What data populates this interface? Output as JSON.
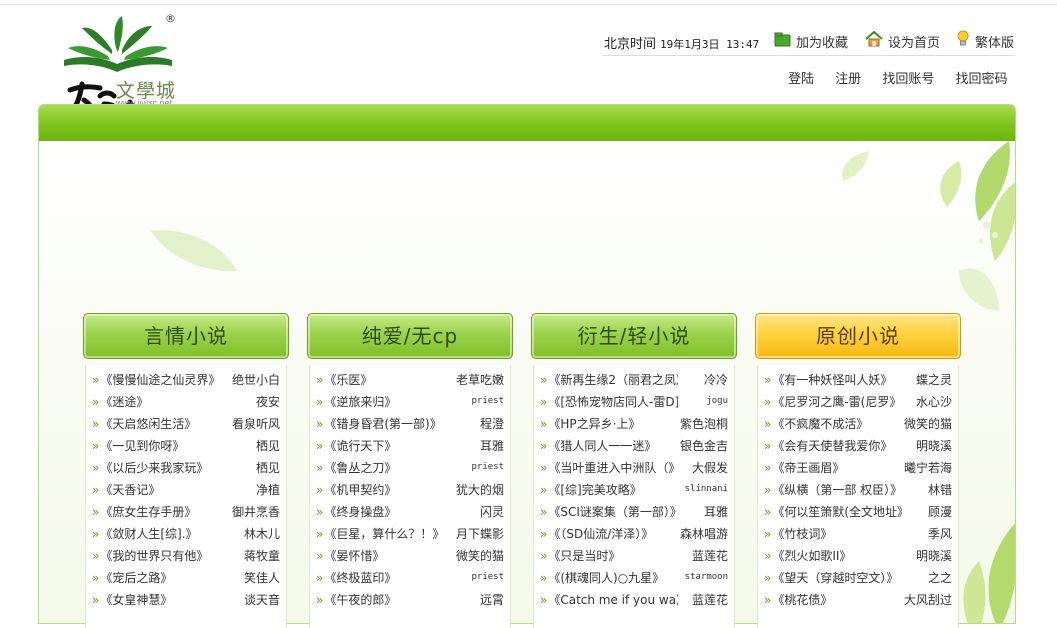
{
  "header": {
    "registered_mark": "®",
    "brand_text": "文學城",
    "brand_url": "www.jjwxc.net",
    "clock_label": "北京时间",
    "clock_value": "19年1月3日 13:47",
    "links": [
      {
        "label": "加为收藏",
        "icon": "folder-icon"
      },
      {
        "label": "设为首页",
        "icon": "home-icon"
      },
      {
        "label": "繁体版",
        "icon": "lightbulb-icon"
      }
    ],
    "account_links": [
      "登陆",
      "注册",
      "找回账号",
      "找回密码"
    ]
  },
  "colors": {
    "accent_green": "#7fc41c",
    "header_yellow": "#ffd23c",
    "link_arrow": "#6aa31b"
  },
  "columns": [
    {
      "title": "言情小说",
      "style": "green",
      "items": [
        {
          "title": "《慢慢仙途之仙灵界》",
          "author": "绝世小白"
        },
        {
          "title": "《迷途》",
          "author": "夜安"
        },
        {
          "title": "《天启悠闲生活》",
          "author": "看泉听风"
        },
        {
          "title": "《一见到你呀》",
          "author": "栖见"
        },
        {
          "title": "《以后少来我家玩》",
          "author": "栖见"
        },
        {
          "title": "《天香记》",
          "author": "净植"
        },
        {
          "title": "《庶女生存手册》",
          "author": "御井烹香"
        },
        {
          "title": "《敛财人生[综].》",
          "author": "林木儿"
        },
        {
          "title": "《我的世界只有他》",
          "author": "蒋牧童"
        },
        {
          "title": "《宠后之路》",
          "author": "笑佳人"
        },
        {
          "title": "《女皇神慧》",
          "author": "谈天音"
        }
      ]
    },
    {
      "title": "纯爱/无cp",
      "style": "green",
      "items": [
        {
          "title": "《乐医》",
          "author": "老草吃嫩"
        },
        {
          "title": "《逆旅来归》",
          "author": "priest"
        },
        {
          "title": "《错身昏君(第一部)》",
          "author": "程澄"
        },
        {
          "title": "《诡行天下》",
          "author": "耳雅"
        },
        {
          "title": "《鲁丛之刀》",
          "author": "priest"
        },
        {
          "title": "《机甲契约》",
          "author": "犹大的烟"
        },
        {
          "title": "《终身操盘》",
          "author": "闪灵"
        },
        {
          "title": "《巨星，算什么？！》",
          "author": "月下蝶影"
        },
        {
          "title": "《晏怀惜》",
          "author": "微笑的猫"
        },
        {
          "title": "《终极蓝印》",
          "author": "priest"
        },
        {
          "title": "《午夜的郎》",
          "author": "远霄"
        }
      ]
    },
    {
      "title": "衍生/轻小说",
      "style": "green",
      "items": [
        {
          "title": "《新再生缘2（丽君之凤》",
          "author": "冷冷"
        },
        {
          "title": "《[恐怖宠物店同人-雷D]》",
          "author": "jogu"
        },
        {
          "title": "《HP之异乡·上》",
          "author": "紫色泡桐"
        },
        {
          "title": "《猎人同人一一迷》",
          "author": "银色金吉"
        },
        {
          "title": "《当叶重进入中洲队（》",
          "author": "大假发"
        },
        {
          "title": "《[综]完美攻略》",
          "author": "slinnani"
        },
        {
          "title": "《SCI谜案集（第一部）》",
          "author": "耳雅"
        },
        {
          "title": "《（SD仙流/洋泽）》",
          "author": "森林唱游"
        },
        {
          "title": "《只是当时》",
          "author": "蓝莲花"
        },
        {
          "title": "《(棋魂同人)○九星》",
          "author": "starmoon"
        },
        {
          "title": "《Catch me if you wa》",
          "author": "蓝莲花"
        }
      ]
    },
    {
      "title": "原创小说",
      "style": "yellow",
      "items": [
        {
          "title": "《有一种妖怪叫人妖》",
          "author": "蝶之灵"
        },
        {
          "title": "《尼罗河之鹰-雷(尼罗》",
          "author": "水心沙"
        },
        {
          "title": "《不疯魔不成活》",
          "author": "微笑的猫"
        },
        {
          "title": "《会有天使替我爱你》",
          "author": "明晓溪"
        },
        {
          "title": "《帝王画眉》",
          "author": "曦宁若海"
        },
        {
          "title": "《纵横（第一部 权臣）》",
          "author": "林错"
        },
        {
          "title": "《何以笙箫默(全文地址》",
          "author": "顾漫"
        },
        {
          "title": "《竹枝词》",
          "author": "季风"
        },
        {
          "title": "《烈火如歌II》",
          "author": "明晓溪"
        },
        {
          "title": "《望天（穿越时空文）》",
          "author": "之之"
        },
        {
          "title": "《桃花债》",
          "author": "大风刮过"
        }
      ]
    }
  ]
}
